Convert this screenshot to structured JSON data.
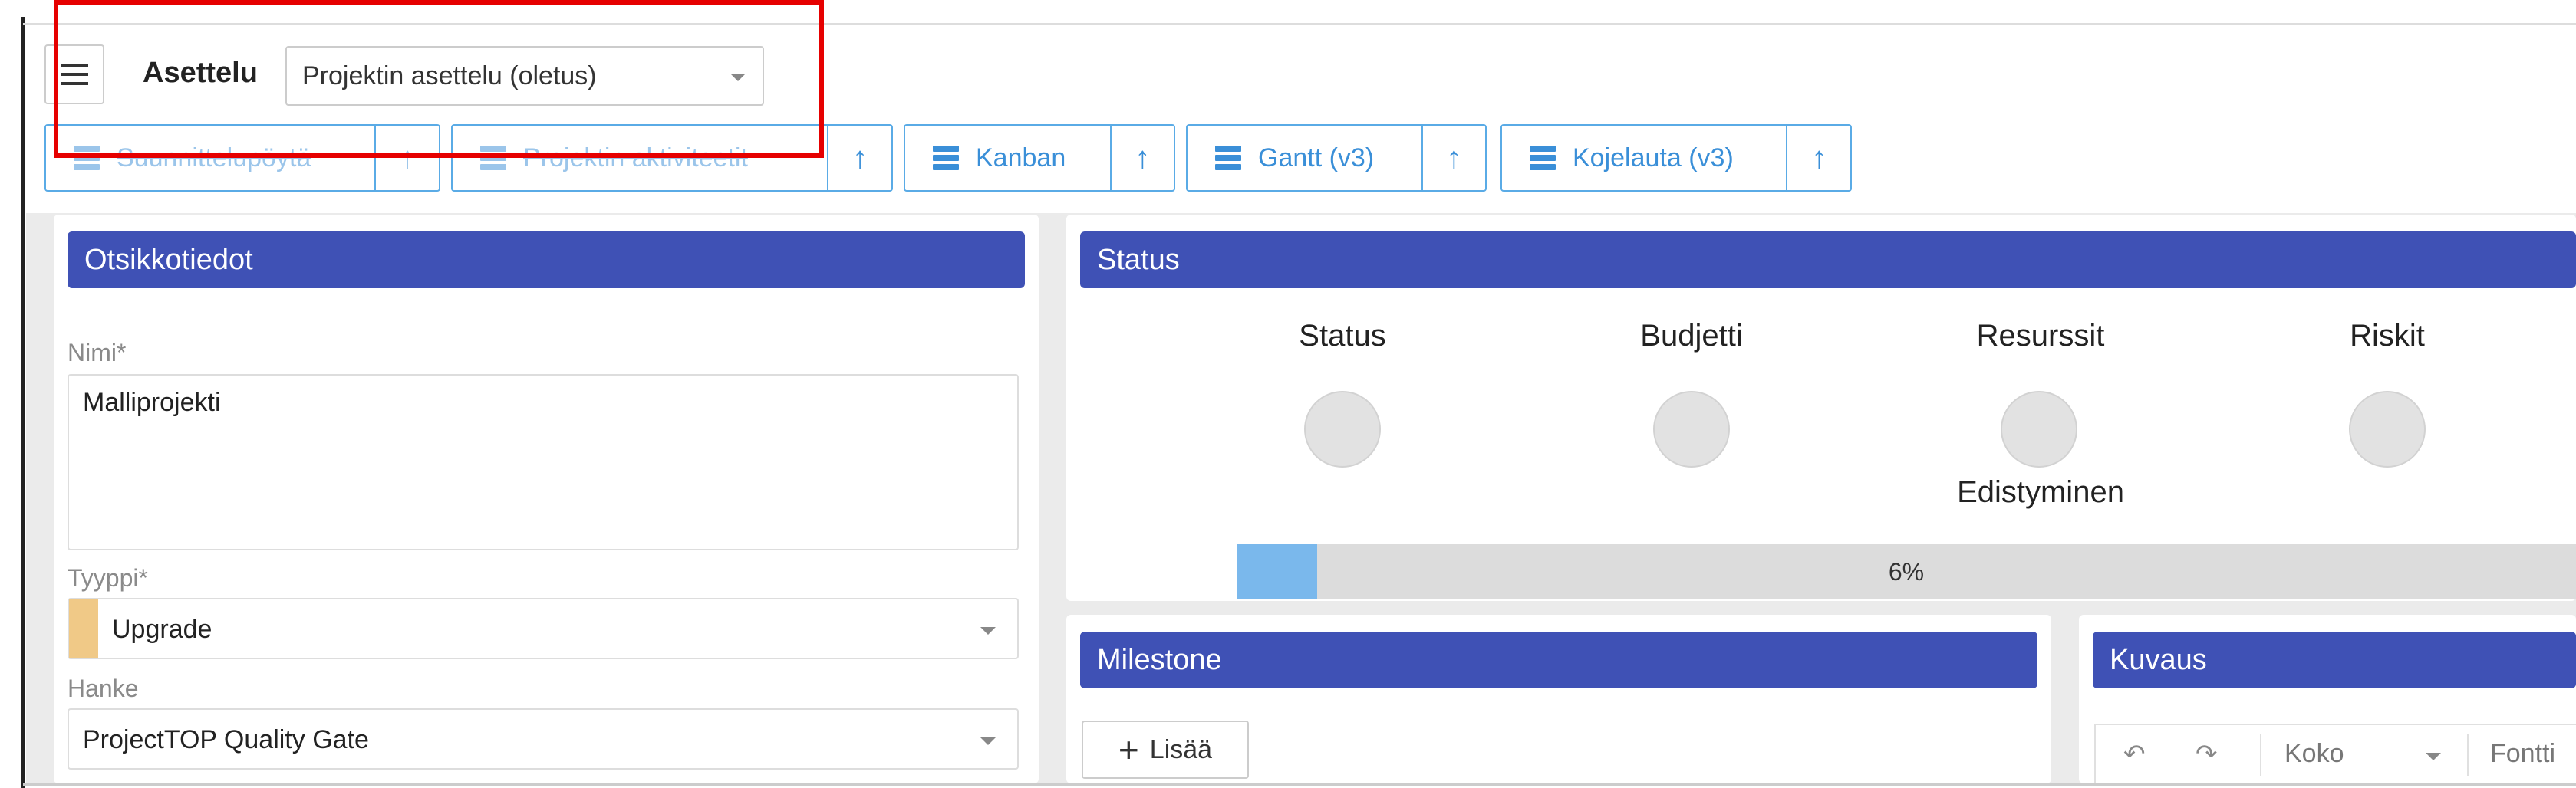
{
  "toolbar": {
    "menu_icon": "hamburger-menu-icon",
    "layout_label": "Asettelu",
    "layout_select_value": "Projektin asettelu (oletus)"
  },
  "tabs": [
    {
      "label": "Suunnittelupöytä",
      "icon": "list-icon"
    },
    {
      "label": "Projektin aktiviteetit",
      "icon": "list-icon"
    },
    {
      "label": "Kanban",
      "icon": "list-icon"
    },
    {
      "label": "Gantt (v3)",
      "icon": "list-icon"
    },
    {
      "label": "Kojelauta (v3)",
      "icon": "list-icon"
    }
  ],
  "header_card": {
    "title": "Otsikkotiedot",
    "name_label": "Nimi*",
    "name_value": "Malliprojekti",
    "type_label": "Tyyppi*",
    "type_value": "Upgrade",
    "type_color": "#f0c987",
    "program_label": "Hanke",
    "program_value": "ProjectTOP Quality Gate"
  },
  "status_card": {
    "title": "Status",
    "indicators": [
      {
        "label": "Status"
      },
      {
        "label": "Budjetti"
      },
      {
        "label": "Resurssit"
      },
      {
        "label": "Riskit"
      }
    ],
    "progress_label": "Edistyminen",
    "progress_percent": 6,
    "progress_text": "6%"
  },
  "milestone_card": {
    "title": "Milestone",
    "add_label": "Lisää"
  },
  "description_card": {
    "title": "Kuvaus",
    "size_label": "Koko",
    "font_label": "Fontti"
  },
  "colors": {
    "header_bg": "#3f51b5",
    "tab_border": "#5aabe6",
    "progress_fill": "#7ab8ec",
    "highlight": "#e60000"
  }
}
